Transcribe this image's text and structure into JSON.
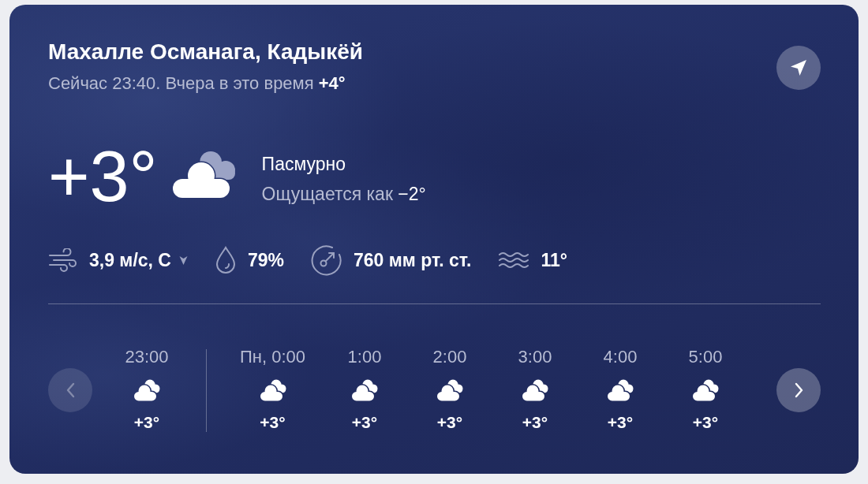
{
  "location": {
    "title": "Махалле Османага, Кадыкёй",
    "subtitle": "Сейчас 23:40. Вчера в это время **+4°**"
  },
  "current": {
    "temperature": "+3°",
    "condition": "Пасмурно",
    "feels_like": "Ощущается как **−2°**"
  },
  "details": [
    {
      "kind": "wind",
      "value": "3,9 м/с, С"
    },
    {
      "kind": "humidity",
      "value": "79%"
    },
    {
      "kind": "pressure",
      "value": "760 мм рт. ст."
    },
    {
      "kind": "water",
      "value": "11°"
    }
  ],
  "hourly": {
    "prev_button": {
      "disabled": true
    },
    "next_button": {
      "disabled": false
    },
    "days": [
      {
        "hours": [
          {
            "time": "23:00",
            "temp": "+3°"
          }
        ]
      },
      {
        "hours": [
          {
            "time": "Пн, 0:00",
            "temp": "+3°"
          },
          {
            "time": "1:00",
            "temp": "+3°"
          },
          {
            "time": "2:00",
            "temp": "+3°"
          },
          {
            "time": "3:00",
            "temp": "+3°"
          },
          {
            "time": "4:00",
            "temp": "+3°"
          },
          {
            "time": "5:00",
            "temp": "+3°"
          }
        ]
      }
    ]
  }
}
